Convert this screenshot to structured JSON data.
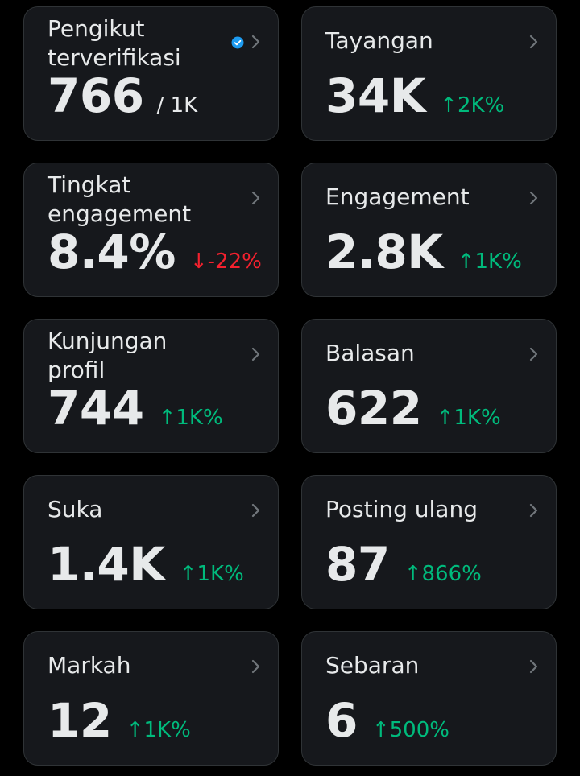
{
  "colors": {
    "background": "#000000",
    "card": "#16181c",
    "card_border": "#2f3336",
    "text": "#e7e9ea",
    "chevron": "#71767b",
    "positive": "#00ba7c",
    "negative": "#f4212e",
    "verified": "#1d9bf0"
  },
  "cards": [
    {
      "label": "Pengikut terverifikasi",
      "value": "766",
      "sub": "/ 1K",
      "change": "",
      "direction": "none",
      "verified_icon": true
    },
    {
      "label": "Tayangan",
      "value": "34K",
      "sub": "",
      "change": "↑2K%",
      "direction": "up"
    },
    {
      "label": "Tingkat engagement",
      "value": "8.4%",
      "sub": "",
      "change": "↓-22%",
      "direction": "down"
    },
    {
      "label": "Engagement",
      "value": "2.8K",
      "sub": "",
      "change": "↑1K%",
      "direction": "up"
    },
    {
      "label": "Kunjungan profil",
      "value": "744",
      "sub": "",
      "change": "↑1K%",
      "direction": "up"
    },
    {
      "label": "Balasan",
      "value": "622",
      "sub": "",
      "change": "↑1K%",
      "direction": "up"
    },
    {
      "label": "Suka",
      "value": "1.4K",
      "sub": "",
      "change": "↑1K%",
      "direction": "up"
    },
    {
      "label": "Posting ulang",
      "value": "87",
      "sub": "",
      "change": "↑866%",
      "direction": "up"
    },
    {
      "label": "Markah",
      "value": "12",
      "sub": "",
      "change": "↑1K%",
      "direction": "up"
    },
    {
      "label": "Sebaran",
      "value": "6",
      "sub": "",
      "change": "↑500%",
      "direction": "up"
    }
  ]
}
